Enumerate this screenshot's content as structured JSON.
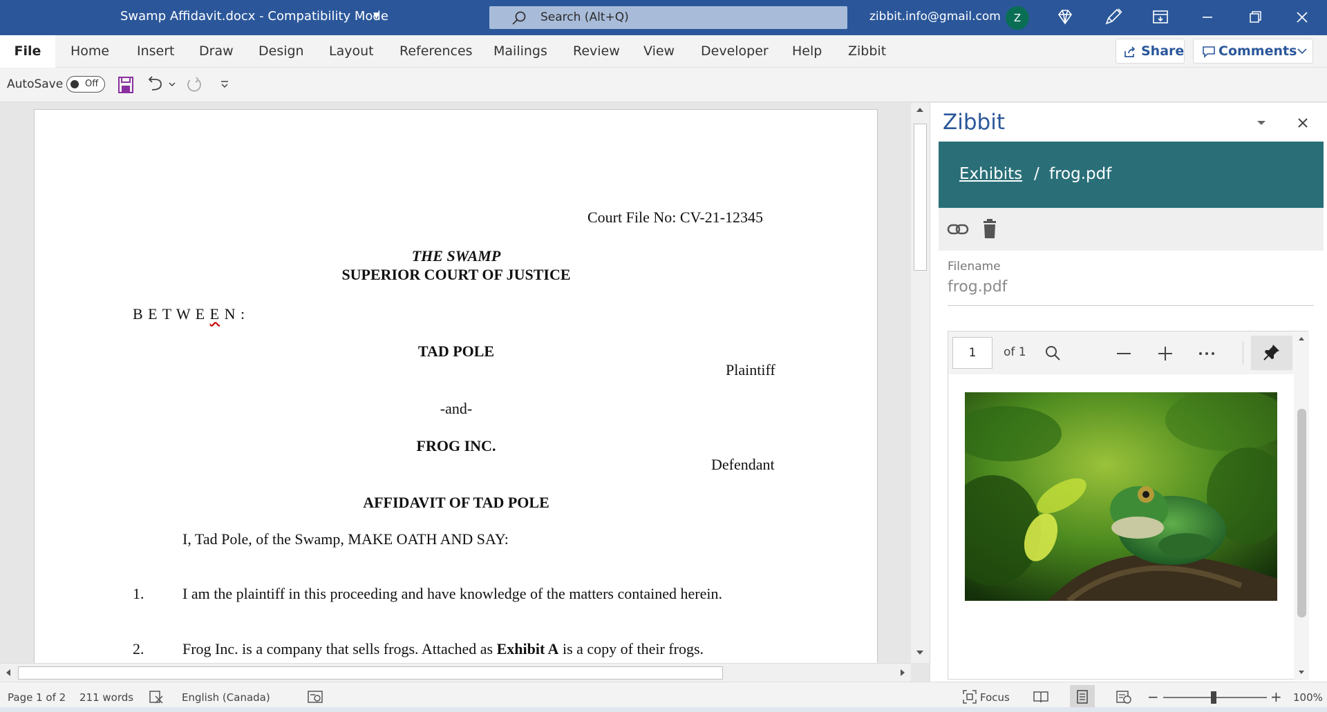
{
  "titlebar": {
    "doc_title": "Swamp Affidavit.docx  -  Compatibility Mode",
    "search_placeholder": "Search (Alt+Q)",
    "account_email": "zibbit.info@gmail.com",
    "avatar_initial": "Z",
    "icons": [
      "diamond-icon",
      "pen-icon",
      "ribbon-display-icon",
      "minimize-icon",
      "restore-icon",
      "close-icon"
    ]
  },
  "menu": {
    "file": "File",
    "tabs": [
      "Home",
      "Insert",
      "Draw",
      "Design",
      "Layout",
      "References",
      "Mailings",
      "Review",
      "View",
      "Developer",
      "Help",
      "Zibbit"
    ],
    "share": "Share",
    "comments": "Comments"
  },
  "qat": {
    "autosave_label": "AutoSave",
    "autosave_state": "Off"
  },
  "document": {
    "court_file": "Court File No: CV-21-12345",
    "court_line1": "THE SWAMP",
    "court_line2": "SUPERIOR COURT OF JUSTICE",
    "between": "B E T W E E N :",
    "plaintiff_name": "TAD POLE",
    "plaintiff_role": "Plaintiff",
    "and": "-and-",
    "defendant_name": "FROG INC.",
    "defendant_role": "Defendant",
    "heading": "AFFIDAVIT OF TAD POLE",
    "intro": "I, Tad Pole, of the Swamp, MAKE OATH AND SAY:",
    "paragraphs": [
      {
        "num": "1.",
        "text": "I am the plaintiff in this proceeding and have knowledge of the matters contained herein."
      },
      {
        "num": "2.",
        "text_before": "Frog Inc. is a company that sells frogs. Attached as ",
        "text_bold": "Exhibit A",
        "text_after": " is a copy of their frogs."
      }
    ]
  },
  "pane": {
    "title": "Zibbit",
    "breadcrumb_link": "Exhibits",
    "breadcrumb_sep": "/",
    "breadcrumb_current": "frog.pdf",
    "filename_label": "Filename",
    "filename_value": "frog.pdf",
    "viewer_page": "1",
    "viewer_of": "of 1"
  },
  "status": {
    "page": "Page 1 of 2",
    "words": "211 words",
    "language": "English (Canada)",
    "focus": "Focus",
    "zoom": "100%"
  },
  "colors": {
    "title_bar": "#2b579a",
    "pane_header": "#2a6f78",
    "avatar": "#0a6e55"
  }
}
